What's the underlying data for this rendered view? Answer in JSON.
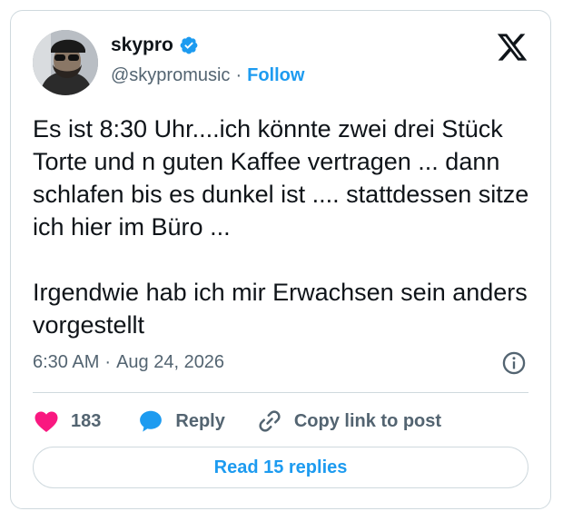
{
  "tweet": {
    "display_name": "skypro",
    "handle": "@skypromusic",
    "separator": "·",
    "follow_label": "Follow",
    "text": "Es ist 8:30 Uhr....ich könnte zwei drei Stück Torte und n guten Kaffee vertragen ... dann schlafen bis es dunkel ist .... stattdessen sitze ich hier im Büro ...\n\nIrgendwie hab ich mir Erwachsen sein anders vorgestellt",
    "time": "6:30 AM",
    "date": "Aug 24, 2026",
    "time_separator": "·"
  },
  "actions": {
    "like_count": "183",
    "reply_label": "Reply",
    "copy_link_label": "Copy link to post"
  },
  "read_replies_label": "Read 15 replies",
  "colors": {
    "accent": "#1d9bf0",
    "like": "#f91880",
    "text": "#0f1419",
    "muted": "#536471",
    "border": "#cfd9de"
  },
  "icons": [
    "verified-badge-icon",
    "x-logo-icon",
    "info-icon",
    "heart-icon",
    "reply-bubble-icon",
    "link-icon"
  ]
}
